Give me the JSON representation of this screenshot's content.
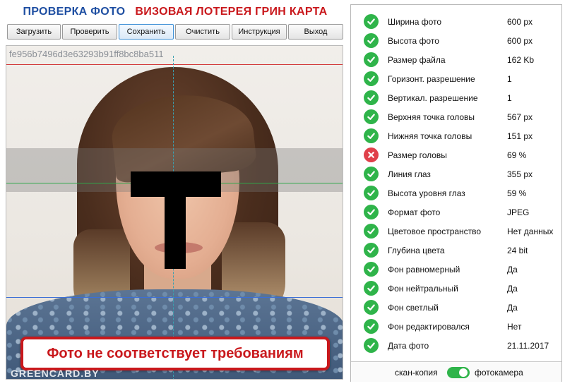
{
  "header": {
    "title_check": "ПРОВЕРКА ФОТО",
    "title_lottery": "ВИЗОВАЯ ЛОТЕРЕЯ ГРИН КАРТА"
  },
  "toolbar": {
    "buttons": [
      "Загрузить",
      "Проверить",
      "Сохранить",
      "Очистить",
      "Инструкция",
      "Выход"
    ]
  },
  "photo": {
    "hash": "fe956b7496d3e63293b91ff8bc8ba511",
    "banner": "Фото не соответствует требованиям",
    "watermark": "GREENCARD.BY"
  },
  "checks": [
    {
      "label": "Ширина фото",
      "value": "600 px",
      "status": "ok"
    },
    {
      "label": "Высота фото",
      "value": "600 px",
      "status": "ok"
    },
    {
      "label": "Размер файла",
      "value": "162 Kb",
      "status": "ok"
    },
    {
      "label": "Горизонт. разрешение",
      "value": "1",
      "status": "ok"
    },
    {
      "label": "Вертикал. разрешение",
      "value": "1",
      "status": "ok"
    },
    {
      "label": "Верхняя точка головы",
      "value": "567 px",
      "status": "ok"
    },
    {
      "label": "Нижняя точка головы",
      "value": "151 px",
      "status": "ok"
    },
    {
      "label": "Размер головы",
      "value": "69 %",
      "status": "fail"
    },
    {
      "label": "Линия глаз",
      "value": "355 px",
      "status": "ok"
    },
    {
      "label": "Высота уровня глаз",
      "value": "59 %",
      "status": "ok"
    },
    {
      "label": "Формат фото",
      "value": "JPEG",
      "status": "ok"
    },
    {
      "label": "Цветовое пространство",
      "value": "Нет данных",
      "status": "ok"
    },
    {
      "label": "Глубина цвета",
      "value": "24 bit",
      "status": "ok"
    },
    {
      "label": "Фон равномерный",
      "value": "Да",
      "status": "ok"
    },
    {
      "label": "Фон нейтральный",
      "value": "Да",
      "status": "ok"
    },
    {
      "label": "Фон светлый",
      "value": "Да",
      "status": "ok"
    },
    {
      "label": "Фон редактировался",
      "value": "Нет",
      "status": "ok"
    },
    {
      "label": "Дата фото",
      "value": "21.11.2017",
      "status": "ok"
    }
  ],
  "footer": {
    "scan_label": "скан-копия",
    "camera_label": "фотокамера",
    "toggle_on": true
  },
  "colors": {
    "title_blue": "#1f4fa2",
    "title_red": "#c9181c",
    "ok_green": "#2fb44a",
    "fail_red": "#e0404a"
  }
}
